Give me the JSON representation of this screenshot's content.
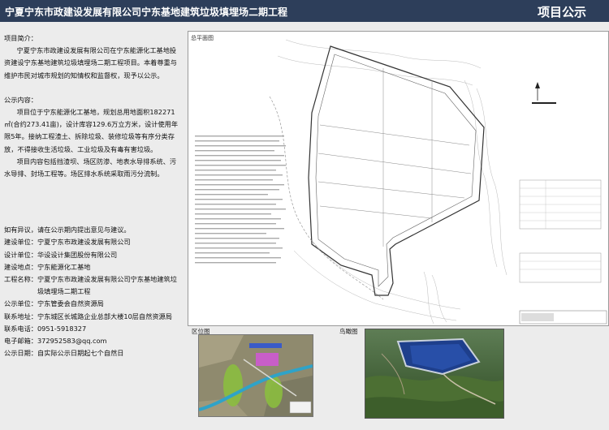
{
  "header": {
    "title": "宁夏宁东市政建设发展有限公司宁东基地建筑垃圾填埋场二期工程",
    "right_label": "项目公示"
  },
  "intro": {
    "heading": "项目简介：",
    "text": "宁夏宁东市政建设发展有限公司在宁东能源化工基地投资建设宁东基地建筑垃圾填埋场二期工程项目。本着尊重与维护市民对城市规划的知情权和监督权，现予以公示。"
  },
  "content": {
    "heading": "公示内容：",
    "para1": "项目位于宁东能源化工基地，规划总用地面积182271㎡(合约273.41亩)，设计库容129.6万立方米，设计使用年限5年。接纳工程渣土、拆除垃圾、装修垃圾等有序分类存放，不得接收生活垃圾、工业垃圾及有毒有害垃圾。",
    "para2": "项目内容包括挡渣坝、场区防渗、地表水导排系统、污水导排、封场工程等。场区排水系统采取雨污分流制。"
  },
  "contact": {
    "intro": "如有异议，请在公示期内提出意见与建议。",
    "rows": [
      {
        "key": "建设单位：",
        "value": "宁夏宁东市政建设发展有限公司"
      },
      {
        "key": "设计单位：",
        "value": "华设设计集团股份有限公司"
      },
      {
        "key": "建设地点：",
        "value": "宁东能源化工基地"
      },
      {
        "key": "工程名称：",
        "value": "宁夏宁东市政建设发展有限公司宁东基地建筑垃圾填埋场二期工程"
      },
      {
        "key": "公示单位：",
        "value": "宁东管委会自然资源局"
      },
      {
        "key": "联系地址：",
        "value": "宁东城区长城路企业总部大楼10层自然资源局"
      },
      {
        "key": "联系电话：",
        "value": " 0951-5918327"
      },
      {
        "key": "电子邮箱：",
        "value": "372952583@qq.com"
      },
      {
        "key": "公示日期：",
        "value": "自实际公示日期起七个自然日"
      }
    ]
  },
  "plan": {
    "label": "总平面图"
  },
  "captions": {
    "location": "区位图",
    "aerial": "鸟瞰图"
  }
}
